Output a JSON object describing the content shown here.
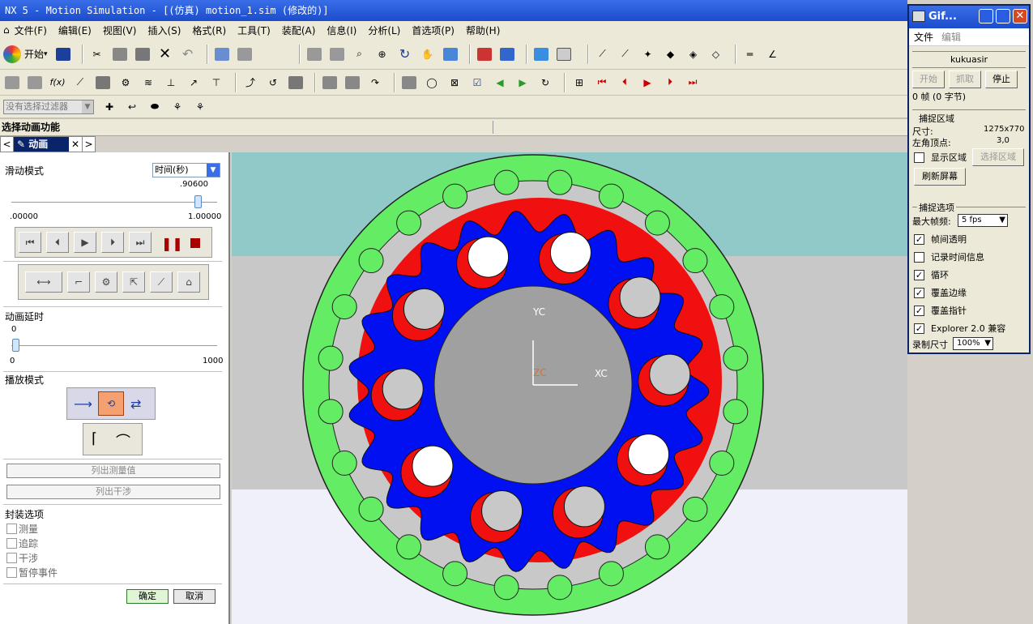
{
  "app": {
    "title": "NX 5 - Motion Simulation - [(仿真) motion_1.sim (修改的)]"
  },
  "menus": [
    "文件(F)",
    "编辑(E)",
    "视图(V)",
    "插入(S)",
    "格式(R)",
    "工具(T)",
    "装配(A)",
    "信息(I)",
    "分析(L)",
    "首选项(P)",
    "帮助(H)"
  ],
  "toolbar": {
    "start_label": "开始",
    "filter_placeholder": "没有选择过滤器"
  },
  "status": {
    "prompt": "选择动画功能"
  },
  "tab": {
    "label": "动画"
  },
  "panel": {
    "slide_mode_label": "滑动模式",
    "slide_mode_value": "时间(秒)",
    "slider_value": ".90600",
    "slider_position": 0.906,
    "slider_min": ".00000",
    "slider_max": "1.00000",
    "delay_label": "动画延时",
    "delay_value": "0",
    "delay_min": "0",
    "delay_max": "1000",
    "play_mode_label": "播放模式",
    "list_measure": "列出测量值",
    "list_interference": "列出干涉",
    "package_options": "封装选项",
    "options": [
      "测量",
      "追踪",
      "干涉",
      "暂停事件"
    ],
    "ok": "确定",
    "cancel": "取消"
  },
  "viewport": {
    "axis_y": "YC",
    "axis_x": "XC",
    "axis_z": "ZC"
  },
  "gif": {
    "title": "Gif...",
    "menu": [
      "文件",
      "编辑"
    ],
    "name": "kukuasir",
    "btn_start": "开始",
    "btn_capture": "抓取",
    "btn_stop": "停止",
    "frames": "0 帧 (0 字节)",
    "capture_area": "捕捉区域",
    "size_label": "尺寸:",
    "size_value": "1275x770",
    "corner_label": "左角顶点:",
    "corner_value": "3,0",
    "show_area": "显示区域",
    "select_area": "选择区域",
    "refresh": "刷新屏幕",
    "capture_options": "捕捉选项",
    "max_fps_label": "最大帧频:",
    "max_fps": "5 fps",
    "options": [
      {
        "label": "帧间透明",
        "checked": true
      },
      {
        "label": "记录时间信息",
        "checked": false
      },
      {
        "label": "循环",
        "checked": true
      },
      {
        "label": "覆盖边缘",
        "checked": true
      },
      {
        "label": "覆盖指针",
        "checked": true
      },
      {
        "label": "Explorer 2.0 兼容",
        "checked": true
      }
    ],
    "record_size_label": "录制尺寸",
    "record_size": "100%"
  },
  "colors": {
    "ring": "#64ec64",
    "rotor": "#0010f0",
    "hole_red": "#f01010",
    "hub": "#a0a0a0",
    "teal": "#91c9c9"
  }
}
